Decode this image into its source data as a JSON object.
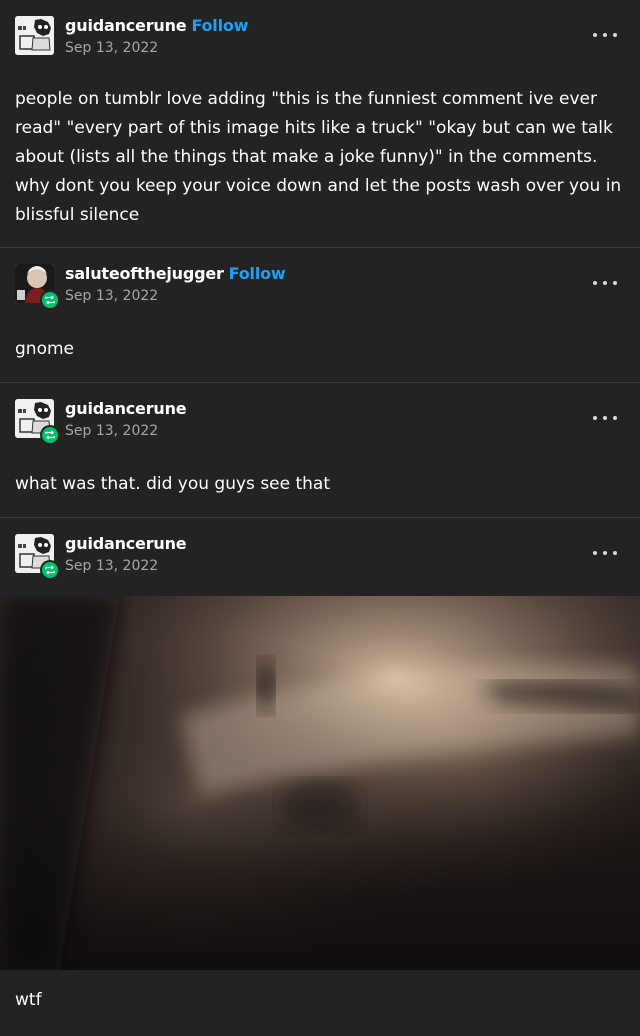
{
  "posts": [
    {
      "username": "guidancerune",
      "follow_label": "Follow",
      "date": "Sep 13, 2022",
      "text": "people on tumblr love adding \"this is the funniest comment ive ever read\" \"every part of this image hits like a truck\" \"okay but can we talk about (lists all the things that make a joke funny)\" in the comments. why dont you keep your voice down and let the posts wash over you in blissful silence"
    },
    {
      "username": "saluteofthejugger",
      "follow_label": "Follow",
      "date": "Sep 13, 2022",
      "text": "gnome"
    },
    {
      "username": "guidancerune",
      "date": "Sep 13, 2022",
      "text": "what was that. did you guys see that"
    },
    {
      "username": "guidancerune",
      "date": "Sep 13, 2022",
      "caption": "wtf"
    }
  ],
  "colors": {
    "background": "#232323",
    "follow": "#1da1f2",
    "reblog_badge": "#00c46a",
    "date": "#a8a8a8"
  },
  "icons": [
    "more-options-icon",
    "reblog-icon"
  ]
}
